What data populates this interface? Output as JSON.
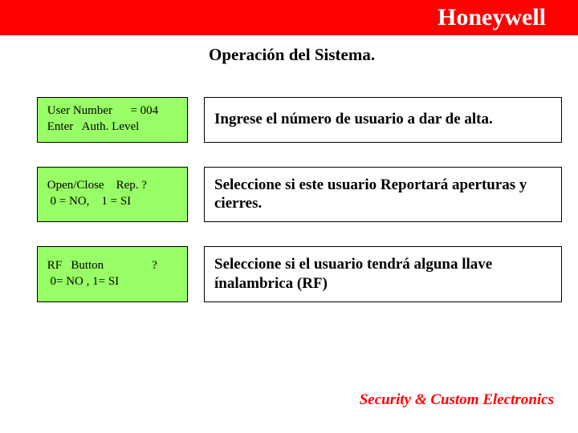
{
  "header": {
    "brand": "Honeywell"
  },
  "section_title": "Operación del Sistema.",
  "rows": [
    {
      "lcd": {
        "line1": " User Number      = 004",
        "line2": " Enter   Auth. Level"
      },
      "desc": "Ingrese el número de usuario a dar de alta."
    },
    {
      "lcd": {
        "line1": " Open/Close    Rep. ?",
        "line2": "  0 = NO,    1 = SI"
      },
      "desc": "Seleccione si este usuario Reportará aperturas y cierres."
    },
    {
      "lcd": {
        "line1": " RF   Button                ?",
        "line2": "  0= NO , 1= SI"
      },
      "desc": "Seleccione si el usuario tendrá alguna llave ínalambrica (RF)"
    }
  ],
  "footer": "Security & Custom Electronics"
}
